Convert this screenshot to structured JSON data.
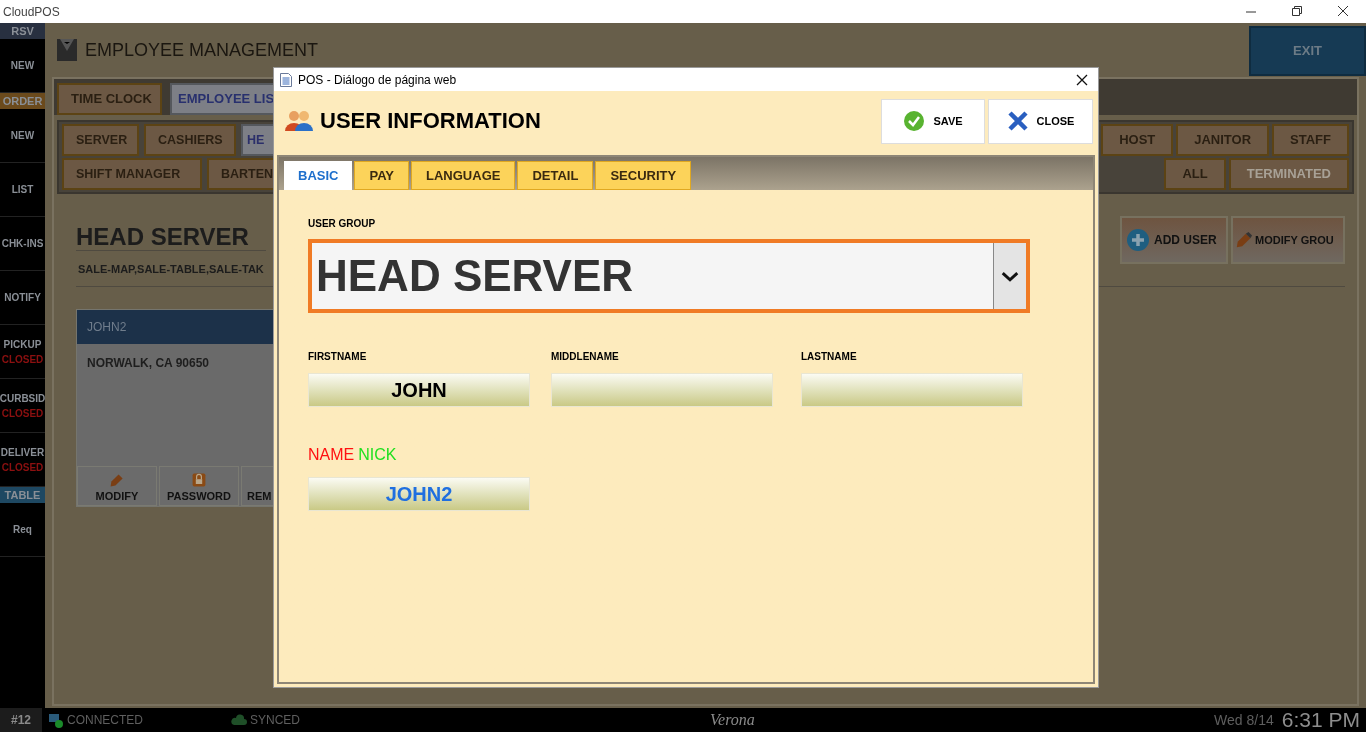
{
  "app_title": "CloudPOS",
  "sidebar": [
    {
      "kind": "header",
      "label": "RSV",
      "color": "#283040"
    },
    {
      "kind": "item",
      "label": "NEW"
    },
    {
      "kind": "header",
      "label": "ORDER",
      "color": "#6b4a1c"
    },
    {
      "kind": "item",
      "label": "NEW"
    },
    {
      "kind": "item",
      "label": "LIST"
    },
    {
      "kind": "item",
      "label": "CHK-INS"
    },
    {
      "kind": "item",
      "label": "NOTIFY"
    },
    {
      "kind": "item",
      "label": "PICKUP",
      "status": "CLOSED"
    },
    {
      "kind": "item",
      "label": "CURBSID",
      "status": "CLOSED"
    },
    {
      "kind": "item",
      "label": "DELIVER",
      "status": "CLOSED"
    },
    {
      "kind": "header",
      "label": "TABLE",
      "color": "#1e4862"
    },
    {
      "kind": "item",
      "label": "Req"
    }
  ],
  "page": {
    "title": "EMPLOYEE MANAGEMENT",
    "exit": "EXIT",
    "main_tabs": [
      {
        "label": "TIME CLOCK",
        "selected": false
      },
      {
        "label": "EMPLOYEE LIS",
        "selected": true
      }
    ],
    "group_tabs_left": [
      [
        {
          "label": "SERVER",
          "selected": false
        },
        {
          "label": "CASHIERS",
          "selected": false
        },
        {
          "label": "HE",
          "selected": true
        }
      ],
      [
        {
          "label": "SHIFT MANAGER",
          "selected": false
        },
        {
          "label": "BARTEN",
          "selected": false
        }
      ]
    ],
    "group_tabs_right": [
      [
        {
          "label": "HOST",
          "disabled": false
        },
        {
          "label": "JANITOR",
          "disabled": false
        },
        {
          "label": "STAFF",
          "disabled": false
        }
      ],
      [
        {
          "label": "ALL",
          "disabled": false
        },
        {
          "label": "TERMINATED",
          "disabled": true
        }
      ]
    ],
    "group_title": "HEAD SERVER",
    "permissions": "SALE-MAP,SALE-TABLE,SALE-TAK",
    "actions": [
      "ADD USER",
      "MODIFY GROU"
    ],
    "card": {
      "name": "JOHN2",
      "address": "NORWALK, CA 90650",
      "buttons": [
        "MODIFY",
        "PASSWORD",
        "REM"
      ]
    }
  },
  "dialog": {
    "title": "POS - Diálogo de página web",
    "heading": "USER INFORMATION",
    "save": "SAVE",
    "close": "CLOSE",
    "tabs": [
      {
        "label": "BASIC",
        "selected": true
      },
      {
        "label": "PAY",
        "selected": false
      },
      {
        "label": "LANGUAGE",
        "selected": false
      },
      {
        "label": "DETAIL",
        "selected": false
      },
      {
        "label": "SECURITY",
        "selected": false
      }
    ],
    "user_group": {
      "label": "USER GROUP",
      "value": "HEAD SERVER"
    },
    "fields": [
      {
        "label": "FIRSTNAME",
        "value": "JOHN"
      },
      {
        "label": "MIDDLENAME"
      },
      {
        "label": "LASTNAME"
      }
    ],
    "nick": {
      "label_1": "NAME",
      "label_2": "NICK",
      "value": "JOHN2"
    }
  },
  "status_bar": {
    "station": "#12",
    "connection": "CONNECTED",
    "sync": "SYNCED",
    "location": "Verona",
    "date": "Wed 8/14",
    "time": "6:31 PM"
  }
}
